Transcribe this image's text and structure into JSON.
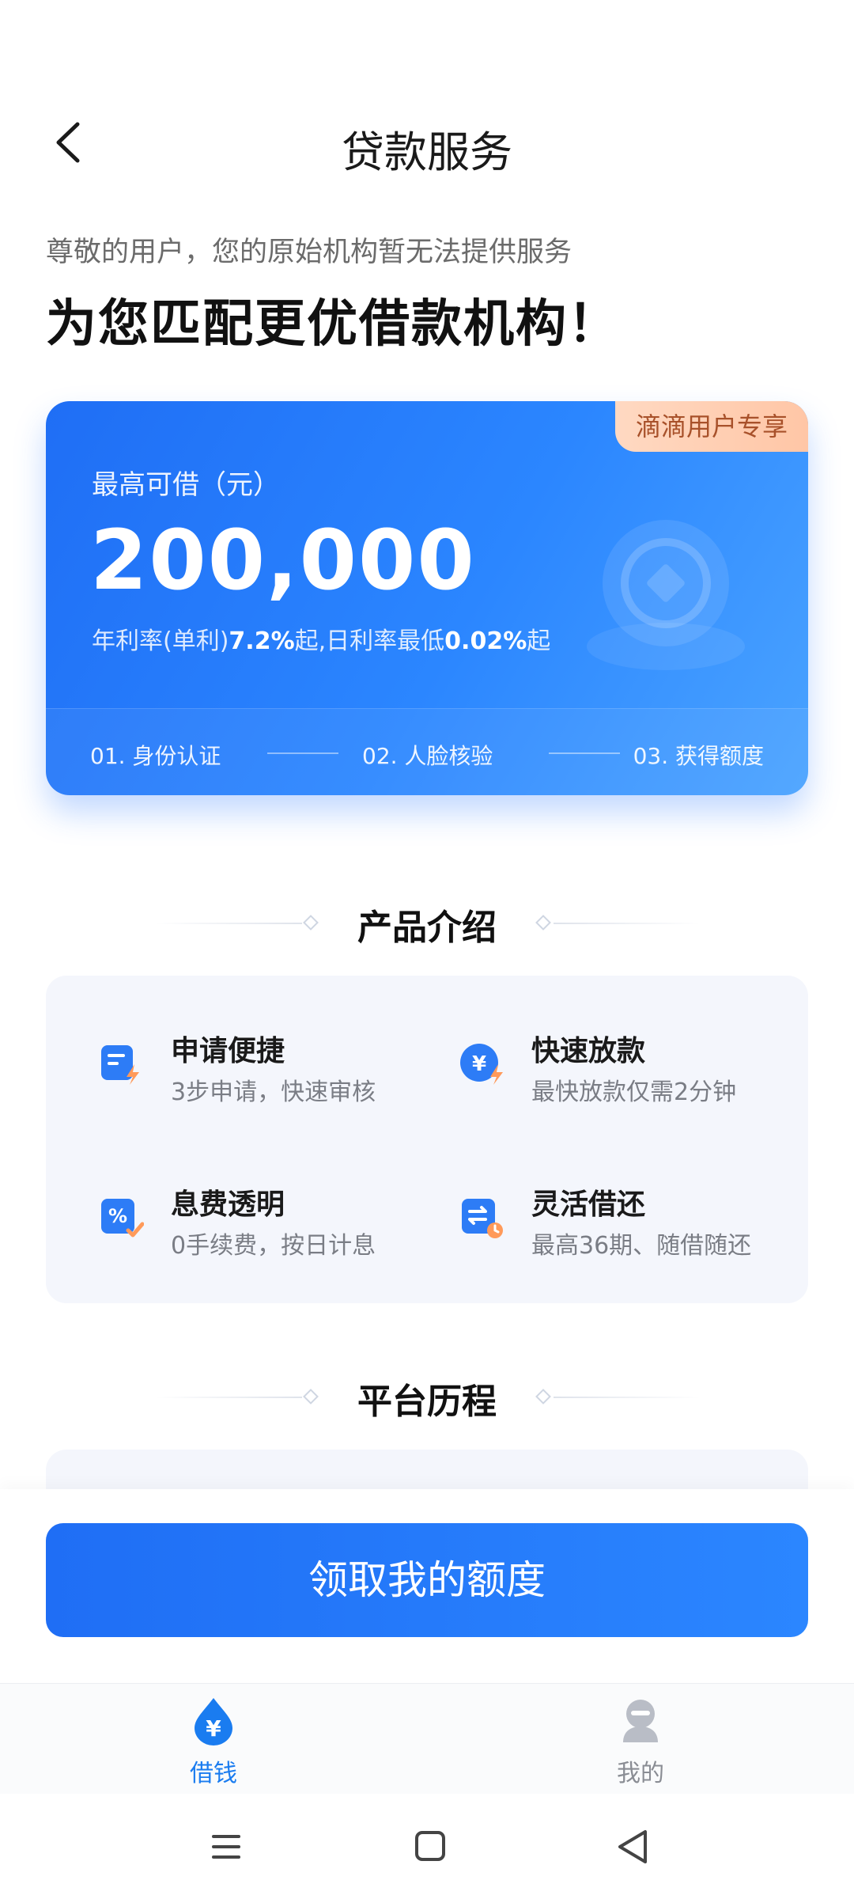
{
  "header": {
    "title": "贷款服务"
  },
  "intro": {
    "subtitle": "尊敬的用户，您的原始机构暂无法提供服务",
    "headline": "为您匹配更优借款机构！"
  },
  "hero": {
    "badge": "滴滴用户专享",
    "limit_label": "最高可借（元）",
    "limit_amount": "200,000",
    "rate_prefix": "年利率(单利)",
    "rate_annual": "7.2%",
    "rate_mid": "起,日利率最低",
    "rate_daily": "0.02%",
    "rate_suffix": "起",
    "steps": [
      "01. 身份认证",
      "02. 人脸核验",
      "03. 获得额度"
    ]
  },
  "products": {
    "section_title": "产品介绍",
    "features": [
      {
        "title": "申请便捷",
        "desc": "3步申请，快速审核",
        "icon": "document-lightning-icon"
      },
      {
        "title": "快速放款",
        "desc": "最快放款仅需2分钟",
        "icon": "yen-lightning-icon"
      },
      {
        "title": "息费透明",
        "desc": "0手续费，按日计息",
        "icon": "percent-check-icon"
      },
      {
        "title": "灵活借还",
        "desc": "最高36期、随借随还",
        "icon": "exchange-clock-icon"
      }
    ]
  },
  "history": {
    "section_title": "平台历程"
  },
  "cta": {
    "label": "领取我的额度"
  },
  "tabbar": {
    "borrow": "借钱",
    "mine": "我的"
  },
  "colors": {
    "accent": "#1f6ef5",
    "badge_text": "#a8512a",
    "tab_active": "#1a7cf0"
  }
}
